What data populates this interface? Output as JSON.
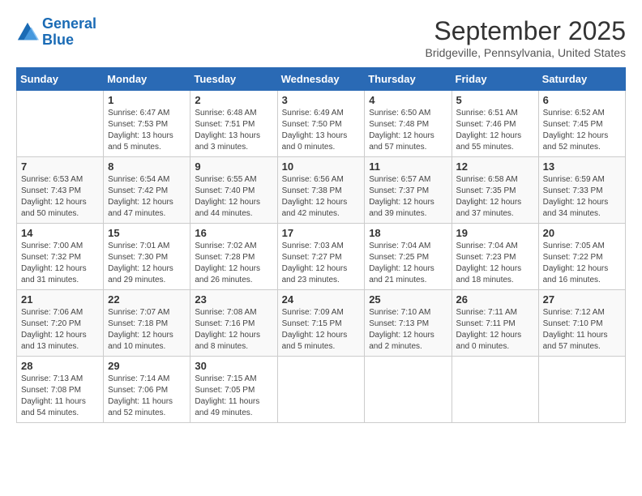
{
  "logo": {
    "line1": "General",
    "line2": "Blue"
  },
  "title": "September 2025",
  "location": "Bridgeville, Pennsylvania, United States",
  "days_header": [
    "Sunday",
    "Monday",
    "Tuesday",
    "Wednesday",
    "Thursday",
    "Friday",
    "Saturday"
  ],
  "weeks": [
    [
      {
        "num": "",
        "info": ""
      },
      {
        "num": "1",
        "info": "Sunrise: 6:47 AM\nSunset: 7:53 PM\nDaylight: 13 hours\nand 5 minutes."
      },
      {
        "num": "2",
        "info": "Sunrise: 6:48 AM\nSunset: 7:51 PM\nDaylight: 13 hours\nand 3 minutes."
      },
      {
        "num": "3",
        "info": "Sunrise: 6:49 AM\nSunset: 7:50 PM\nDaylight: 13 hours\nand 0 minutes."
      },
      {
        "num": "4",
        "info": "Sunrise: 6:50 AM\nSunset: 7:48 PM\nDaylight: 12 hours\nand 57 minutes."
      },
      {
        "num": "5",
        "info": "Sunrise: 6:51 AM\nSunset: 7:46 PM\nDaylight: 12 hours\nand 55 minutes."
      },
      {
        "num": "6",
        "info": "Sunrise: 6:52 AM\nSunset: 7:45 PM\nDaylight: 12 hours\nand 52 minutes."
      }
    ],
    [
      {
        "num": "7",
        "info": "Sunrise: 6:53 AM\nSunset: 7:43 PM\nDaylight: 12 hours\nand 50 minutes."
      },
      {
        "num": "8",
        "info": "Sunrise: 6:54 AM\nSunset: 7:42 PM\nDaylight: 12 hours\nand 47 minutes."
      },
      {
        "num": "9",
        "info": "Sunrise: 6:55 AM\nSunset: 7:40 PM\nDaylight: 12 hours\nand 44 minutes."
      },
      {
        "num": "10",
        "info": "Sunrise: 6:56 AM\nSunset: 7:38 PM\nDaylight: 12 hours\nand 42 minutes."
      },
      {
        "num": "11",
        "info": "Sunrise: 6:57 AM\nSunset: 7:37 PM\nDaylight: 12 hours\nand 39 minutes."
      },
      {
        "num": "12",
        "info": "Sunrise: 6:58 AM\nSunset: 7:35 PM\nDaylight: 12 hours\nand 37 minutes."
      },
      {
        "num": "13",
        "info": "Sunrise: 6:59 AM\nSunset: 7:33 PM\nDaylight: 12 hours\nand 34 minutes."
      }
    ],
    [
      {
        "num": "14",
        "info": "Sunrise: 7:00 AM\nSunset: 7:32 PM\nDaylight: 12 hours\nand 31 minutes."
      },
      {
        "num": "15",
        "info": "Sunrise: 7:01 AM\nSunset: 7:30 PM\nDaylight: 12 hours\nand 29 minutes."
      },
      {
        "num": "16",
        "info": "Sunrise: 7:02 AM\nSunset: 7:28 PM\nDaylight: 12 hours\nand 26 minutes."
      },
      {
        "num": "17",
        "info": "Sunrise: 7:03 AM\nSunset: 7:27 PM\nDaylight: 12 hours\nand 23 minutes."
      },
      {
        "num": "18",
        "info": "Sunrise: 7:04 AM\nSunset: 7:25 PM\nDaylight: 12 hours\nand 21 minutes."
      },
      {
        "num": "19",
        "info": "Sunrise: 7:04 AM\nSunset: 7:23 PM\nDaylight: 12 hours\nand 18 minutes."
      },
      {
        "num": "20",
        "info": "Sunrise: 7:05 AM\nSunset: 7:22 PM\nDaylight: 12 hours\nand 16 minutes."
      }
    ],
    [
      {
        "num": "21",
        "info": "Sunrise: 7:06 AM\nSunset: 7:20 PM\nDaylight: 12 hours\nand 13 minutes."
      },
      {
        "num": "22",
        "info": "Sunrise: 7:07 AM\nSunset: 7:18 PM\nDaylight: 12 hours\nand 10 minutes."
      },
      {
        "num": "23",
        "info": "Sunrise: 7:08 AM\nSunset: 7:16 PM\nDaylight: 12 hours\nand 8 minutes."
      },
      {
        "num": "24",
        "info": "Sunrise: 7:09 AM\nSunset: 7:15 PM\nDaylight: 12 hours\nand 5 minutes."
      },
      {
        "num": "25",
        "info": "Sunrise: 7:10 AM\nSunset: 7:13 PM\nDaylight: 12 hours\nand 2 minutes."
      },
      {
        "num": "26",
        "info": "Sunrise: 7:11 AM\nSunset: 7:11 PM\nDaylight: 12 hours\nand 0 minutes."
      },
      {
        "num": "27",
        "info": "Sunrise: 7:12 AM\nSunset: 7:10 PM\nDaylight: 11 hours\nand 57 minutes."
      }
    ],
    [
      {
        "num": "28",
        "info": "Sunrise: 7:13 AM\nSunset: 7:08 PM\nDaylight: 11 hours\nand 54 minutes."
      },
      {
        "num": "29",
        "info": "Sunrise: 7:14 AM\nSunset: 7:06 PM\nDaylight: 11 hours\nand 52 minutes."
      },
      {
        "num": "30",
        "info": "Sunrise: 7:15 AM\nSunset: 7:05 PM\nDaylight: 11 hours\nand 49 minutes."
      },
      {
        "num": "",
        "info": ""
      },
      {
        "num": "",
        "info": ""
      },
      {
        "num": "",
        "info": ""
      },
      {
        "num": "",
        "info": ""
      }
    ]
  ]
}
